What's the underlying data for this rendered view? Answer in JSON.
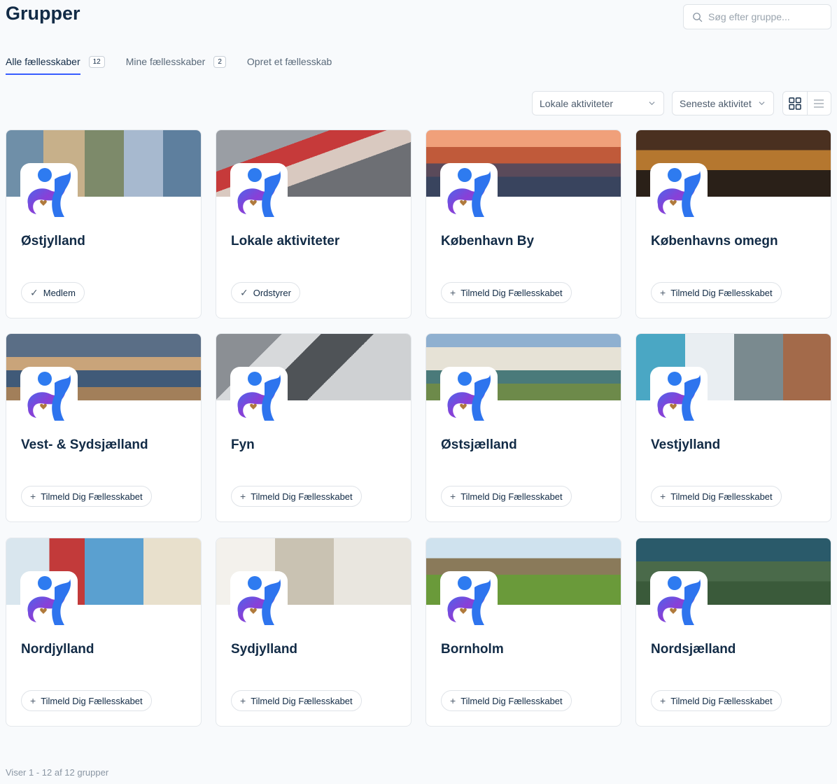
{
  "header": {
    "title": "Grupper",
    "search_placeholder": "Søg efter gruppe..."
  },
  "tabs": [
    {
      "label": "Alle fællesskaber",
      "count": "12",
      "active": true
    },
    {
      "label": "Mine fællesskaber",
      "count": "2",
      "active": false
    },
    {
      "label": "Opret et fællesskab",
      "count": null,
      "active": false
    }
  ],
  "filters": {
    "type_selected": "Lokale aktiviteter",
    "order_selected": "Seneste aktivitet"
  },
  "groups": [
    {
      "name": "Østjylland",
      "button": "Medlem",
      "button_icon": "check-icon"
    },
    {
      "name": "Lokale aktiviteter",
      "button": "Ordstyrer",
      "button_icon": "check-icon"
    },
    {
      "name": "København By",
      "button": "Tilmeld Dig Fællesskabet",
      "button_icon": "plus-icon"
    },
    {
      "name": "Københavns omegn",
      "button": "Tilmeld Dig Fællesskabet",
      "button_icon": "plus-icon"
    },
    {
      "name": "Vest- & Sydsjælland",
      "button": "Tilmeld Dig Fællesskabet",
      "button_icon": "plus-icon"
    },
    {
      "name": "Fyn",
      "button": "Tilmeld Dig Fællesskabet",
      "button_icon": "plus-icon"
    },
    {
      "name": "Østsjælland",
      "button": "Tilmeld Dig Fællesskabet",
      "button_icon": "plus-icon"
    },
    {
      "name": "Vestjylland",
      "button": "Tilmeld Dig Fællesskabet",
      "button_icon": "plus-icon"
    },
    {
      "name": "Nordjylland",
      "button": "Tilmeld Dig Fællesskabet",
      "button_icon": "plus-icon"
    },
    {
      "name": "Sydjylland",
      "button": "Tilmeld Dig Fællesskabet",
      "button_icon": "plus-icon"
    },
    {
      "name": "Bornholm",
      "button": "Tilmeld Dig Fællesskabet",
      "button_icon": "plus-icon"
    },
    {
      "name": "Nordsjælland",
      "button": "Tilmeld Dig Fællesskabet",
      "button_icon": "plus-icon"
    }
  ],
  "footer": {
    "count_text": "Viser 1 - 12 af 12 grupper"
  },
  "colors": {
    "accent": "#385dff",
    "title": "#122b46"
  }
}
